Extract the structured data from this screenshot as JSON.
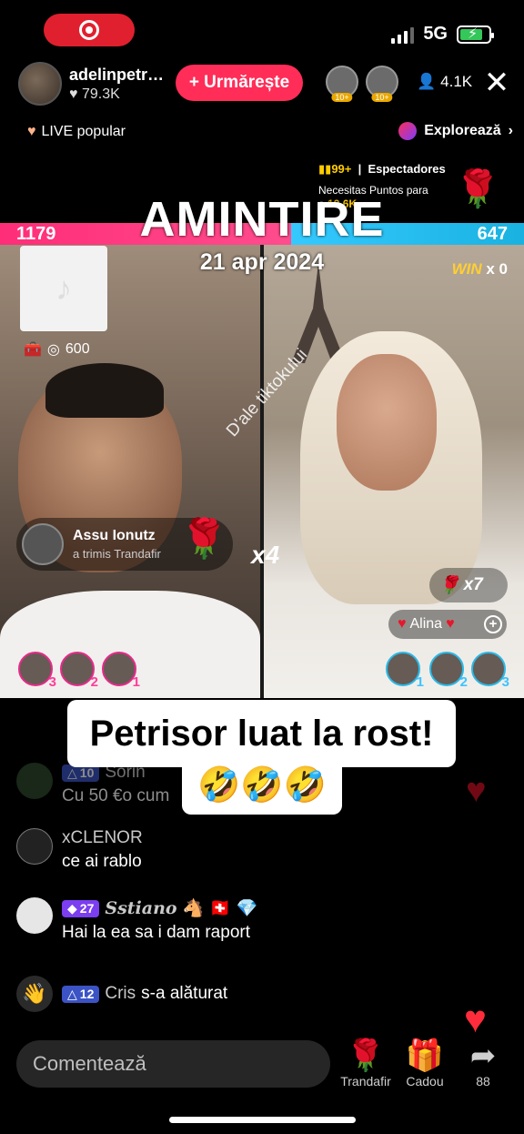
{
  "status_bar": {
    "network": "5G"
  },
  "header": {
    "host_name": "adelinpetr…",
    "host_likes": "79.3K",
    "follow_label": "+ Urmărește",
    "viewer_badges": [
      "10+",
      "10+"
    ],
    "viewer_count": "4.1K",
    "popular_label": "LIVE popular",
    "explore_label": "Explorează"
  },
  "rank_info": {
    "rank": "99+",
    "rank_label": "Espectadores",
    "points_line1": "Necesitas Puntos para",
    "points_line2_prefix": "a",
    "points_value": "19.6K"
  },
  "battle": {
    "score_left": "1179",
    "score_right": "647",
    "win_label": "WIN",
    "win_count": "x 0"
  },
  "overlay": {
    "title": "AMINTIRE",
    "date": "21 apr 2024",
    "watermark": "D'ale tiktokului"
  },
  "left_pane": {
    "coins": "600"
  },
  "gift_notice": {
    "name": "Assu Ionutz",
    "action": "a trimis Trandafir",
    "multiplier": "x4"
  },
  "right_pane": {
    "rose_count": "x7",
    "alina_label": "Alina"
  },
  "left_supporters": [
    "3",
    "2",
    "1"
  ],
  "right_supporters": [
    "1",
    "2",
    "3"
  ],
  "caption": {
    "main": "Petrisor luat la rost!",
    "emoji": "🤣🤣🤣"
  },
  "comments": [
    {
      "level": "10",
      "user": "Sorin",
      "text": "Cu 50 €o cum"
    },
    {
      "user": "xCLENOR",
      "text": "ce ai rablo"
    },
    {
      "level": "27",
      "user": "Sstiano",
      "text": "Hai la ea sa i dam raport"
    },
    {
      "level": "12",
      "user": "Cris",
      "text": "s-a alăturat"
    }
  ],
  "bottom_bar": {
    "comment_placeholder": "Comentează",
    "rose_label": "Trandafir",
    "gift_label": "Cadou",
    "share_count": "88"
  }
}
